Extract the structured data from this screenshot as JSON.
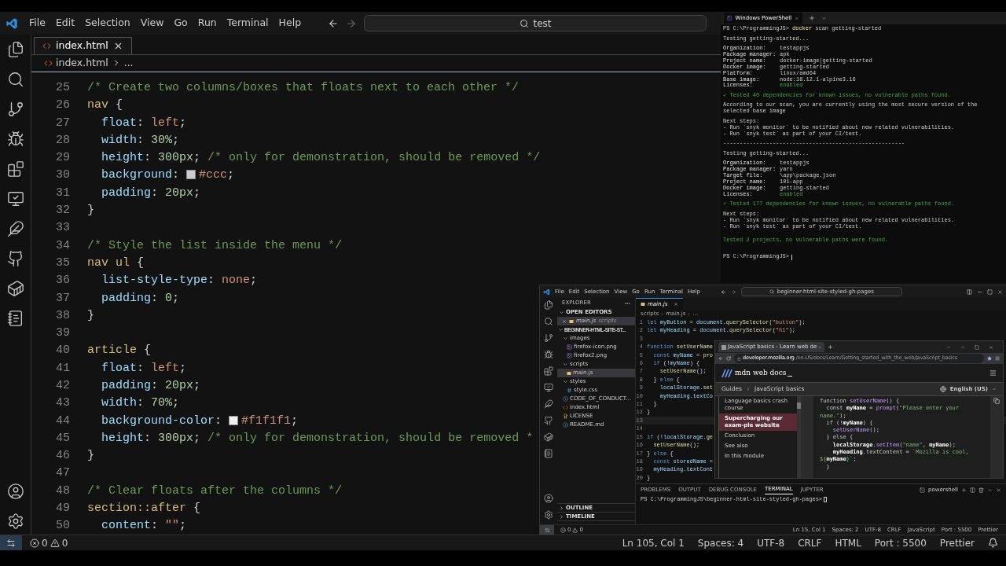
{
  "titlebar": {
    "menu": [
      "File",
      "Edit",
      "Selection",
      "View",
      "Go",
      "Run",
      "Terminal",
      "Help"
    ],
    "search": "test"
  },
  "editor": {
    "tabs": [
      {
        "label": "index.html",
        "selected": true
      }
    ],
    "breadcrumb": [
      "index.html",
      "..."
    ],
    "lines": [
      {
        "n": "25",
        "tokens": [
          {
            "kind": "com",
            "text": "/* Create two columns/boxes that floats next to each other */"
          }
        ]
      },
      {
        "n": "26",
        "tokens": [
          {
            "kind": "sel",
            "text": "nav"
          },
          {
            "kind": "punc",
            "text": " {"
          }
        ]
      },
      {
        "n": "27",
        "tokens": [
          {
            "kind": "prop",
            "text": "  float"
          },
          {
            "kind": "punc",
            "text": ": "
          },
          {
            "kind": "val",
            "text": "left"
          },
          {
            "kind": "punc",
            "text": ";"
          }
        ]
      },
      {
        "n": "28",
        "tokens": [
          {
            "kind": "prop",
            "text": "  width"
          },
          {
            "kind": "punc",
            "text": ": "
          },
          {
            "kind": "num",
            "text": "30%"
          },
          {
            "kind": "punc",
            "text": ";"
          }
        ]
      },
      {
        "n": "29",
        "tokens": [
          {
            "kind": "prop",
            "text": "  height"
          },
          {
            "kind": "punc",
            "text": ": "
          },
          {
            "kind": "num",
            "text": "300"
          },
          {
            "kind": "unit",
            "text": "px"
          },
          {
            "kind": "punc",
            "text": "; "
          },
          {
            "kind": "com",
            "text": "/* only for demonstration, should be removed */"
          }
        ]
      },
      {
        "n": "30",
        "tokens": [
          {
            "kind": "prop",
            "text": "  background"
          },
          {
            "kind": "punc",
            "text": ": "
          },
          {
            "kind": "swatch",
            "color": "#cccccc"
          },
          {
            "kind": "val",
            "text": "#ccc"
          },
          {
            "kind": "punc",
            "text": ";"
          }
        ]
      },
      {
        "n": "31",
        "tokens": [
          {
            "kind": "prop",
            "text": "  padding"
          },
          {
            "kind": "punc",
            "text": ": "
          },
          {
            "kind": "num",
            "text": "20"
          },
          {
            "kind": "unit",
            "text": "px"
          },
          {
            "kind": "punc",
            "text": ";"
          }
        ]
      },
      {
        "n": "32",
        "tokens": [
          {
            "kind": "punc",
            "text": "}"
          }
        ]
      },
      {
        "n": "33"
      },
      {
        "n": "34",
        "tokens": [
          {
            "kind": "com",
            "text": "/* Style the list inside the menu */"
          }
        ]
      },
      {
        "n": "35",
        "tokens": [
          {
            "kind": "sel",
            "text": "nav ul"
          },
          {
            "kind": "punc",
            "text": " {"
          }
        ]
      },
      {
        "n": "36",
        "tokens": [
          {
            "kind": "prop",
            "text": "  list-style-type"
          },
          {
            "kind": "punc",
            "text": ": "
          },
          {
            "kind": "val",
            "text": "none"
          },
          {
            "kind": "punc",
            "text": ";"
          }
        ]
      },
      {
        "n": "37",
        "tokens": [
          {
            "kind": "prop",
            "text": "  padding"
          },
          {
            "kind": "punc",
            "text": ": "
          },
          {
            "kind": "num",
            "text": "0"
          },
          {
            "kind": "punc",
            "text": ";"
          }
        ]
      },
      {
        "n": "38",
        "tokens": [
          {
            "kind": "punc",
            "text": "}"
          }
        ]
      },
      {
        "n": "39"
      },
      {
        "n": "40",
        "tokens": [
          {
            "kind": "sel",
            "text": "article"
          },
          {
            "kind": "punc",
            "text": " {"
          }
        ]
      },
      {
        "n": "41",
        "tokens": [
          {
            "kind": "prop",
            "text": "  float"
          },
          {
            "kind": "punc",
            "text": ": "
          },
          {
            "kind": "val",
            "text": "left"
          },
          {
            "kind": "punc",
            "text": ";"
          }
        ]
      },
      {
        "n": "42",
        "tokens": [
          {
            "kind": "prop",
            "text": "  padding"
          },
          {
            "kind": "punc",
            "text": ": "
          },
          {
            "kind": "num",
            "text": "20"
          },
          {
            "kind": "unit",
            "text": "px"
          },
          {
            "kind": "punc",
            "text": ";"
          }
        ]
      },
      {
        "n": "43",
        "tokens": [
          {
            "kind": "prop",
            "text": "  width"
          },
          {
            "kind": "punc",
            "text": ": "
          },
          {
            "kind": "num",
            "text": "70%"
          },
          {
            "kind": "punc",
            "text": ";"
          }
        ]
      },
      {
        "n": "44",
        "tokens": [
          {
            "kind": "prop",
            "text": "  background-color"
          },
          {
            "kind": "punc",
            "text": ": "
          },
          {
            "kind": "swatch",
            "color": "#f1f1f1"
          },
          {
            "kind": "val",
            "text": "#f1f1f1"
          },
          {
            "kind": "punc",
            "text": ";"
          }
        ]
      },
      {
        "n": "45",
        "tokens": [
          {
            "kind": "prop",
            "text": "  height"
          },
          {
            "kind": "punc",
            "text": ": "
          },
          {
            "kind": "num",
            "text": "300"
          },
          {
            "kind": "unit",
            "text": "px"
          },
          {
            "kind": "punc",
            "text": "; "
          },
          {
            "kind": "com",
            "text": "/* only for demonstration, should be removed *"
          }
        ]
      },
      {
        "n": "46",
        "tokens": [
          {
            "kind": "punc",
            "text": "}"
          }
        ]
      },
      {
        "n": "47"
      },
      {
        "n": "48",
        "tokens": [
          {
            "kind": "com",
            "text": "/* Clear floats after the columns */"
          }
        ]
      },
      {
        "n": "49",
        "tokens": [
          {
            "kind": "sel",
            "text": "section::after"
          },
          {
            "kind": "punc",
            "text": " {"
          }
        ]
      },
      {
        "n": "50",
        "tokens": [
          {
            "kind": "prop",
            "text": "  content"
          },
          {
            "kind": "punc",
            "text": ": "
          },
          {
            "kind": "val",
            "text": "\"\""
          },
          {
            "kind": "punc",
            "text": ";"
          }
        ]
      }
    ]
  },
  "status_bar": {
    "problems": {
      "errors": "0",
      "warnings": "0"
    },
    "items": [
      "Ln 105, Col 1",
      "Spaces: 4",
      "UTF-8",
      "CRLF",
      "HTML",
      "Port : 5500",
      "Prettier"
    ]
  },
  "terminal": {
    "tabs": [
      {
        "title": "Windows PowerShell",
        "selected": true
      }
    ],
    "lines": [
      {
        "kind": "prompt",
        "prompt": "PS C:\\ProgrammingJS>",
        "cmd": "docker",
        "args": "scan getting-started"
      },
      {
        "kind": "blank"
      },
      {
        "kind": "text",
        "text": "Testing getting-started..."
      },
      {
        "kind": "blank"
      },
      {
        "kind": "field",
        "label": "Organization:",
        "value": "testappjs",
        "highlight": false
      },
      {
        "kind": "field",
        "label": "Package manager:",
        "value": "apk",
        "highlight": false
      },
      {
        "kind": "field",
        "label": "Project name:",
        "value": "docker-image|getting-started",
        "highlight": false
      },
      {
        "kind": "field",
        "label": "Docker image:",
        "value": "getting-started",
        "highlight": false
      },
      {
        "kind": "field",
        "label": "Platform:",
        "value": "linux/amd64",
        "highlight": false
      },
      {
        "kind": "field",
        "label": "Base image:",
        "value": "node:18.12.1-alpine3.16",
        "highlight": false
      },
      {
        "kind": "field",
        "label": "Licenses:",
        "value": "enabled",
        "highlight": true
      },
      {
        "kind": "blank"
      },
      {
        "kind": "success",
        "text": "✓ Tested 40 dependencies for known issues, no vulnerable paths found."
      },
      {
        "kind": "blank"
      },
      {
        "kind": "text",
        "text": "According to our scan, you are currently using the most secure version of the selected base image"
      },
      {
        "kind": "blank"
      },
      {
        "kind": "text",
        "text": "Next steps:"
      },
      {
        "kind": "text",
        "text": "- Run `snyk monitor` to be notified about new related vulnerabilities."
      },
      {
        "kind": "text",
        "text": "- Run `snyk test` as part of your CI/test."
      },
      {
        "kind": "blank"
      },
      {
        "kind": "text",
        "text": "-------------------------------------------------------"
      },
      {
        "kind": "blank"
      },
      {
        "kind": "text",
        "text": "Testing getting-started..."
      },
      {
        "kind": "blank"
      },
      {
        "kind": "field",
        "label": "Organization:",
        "value": "testappjs",
        "highlight": false
      },
      {
        "kind": "field",
        "label": "Package manager:",
        "value": "yarn",
        "highlight": false
      },
      {
        "kind": "field",
        "label": "Target file:",
        "value": "\\app\\package.json",
        "highlight": false
      },
      {
        "kind": "field",
        "label": "Project name:",
        "value": "101-app",
        "highlight": false
      },
      {
        "kind": "field",
        "label": "Docker image:",
        "value": "getting-started",
        "highlight": false
      },
      {
        "kind": "field",
        "label": "Licenses:",
        "value": "enabled",
        "highlight": true
      },
      {
        "kind": "blank"
      },
      {
        "kind": "success",
        "text": "✓ Tested 177 dependencies for known issues, no vulnerable paths found."
      },
      {
        "kind": "blank"
      },
      {
        "kind": "text",
        "text": "Next steps:"
      },
      {
        "kind": "text",
        "text": "- Run `snyk monitor` to be notified about new related vulnerabilities."
      },
      {
        "kind": "text",
        "text": "- Run `snyk test` as part of your CI/test."
      },
      {
        "kind": "blank"
      },
      {
        "kind": "blank"
      },
      {
        "kind": "success",
        "text": "Tested 2 projects, no vulnerable paths were found."
      },
      {
        "kind": "blank"
      },
      {
        "kind": "blank"
      },
      {
        "kind": "blank"
      },
      {
        "kind": "prompt",
        "prompt": "PS C:\\ProgrammingJS>"
      }
    ]
  },
  "vscode": {
    "menu": [
      "File",
      "Edit",
      "Selection",
      "View",
      "Go",
      "Run",
      "Terminal",
      "Help"
    ],
    "search": "beginner-html-site-styled-gh-pages",
    "explorer": {
      "title": "EXPLORER",
      "open_editors_title": "OPEN EDITORS",
      "open_editors": [
        {
          "name": "main.js",
          "folder": "scripts",
          "kind": "js",
          "selected": true
        }
      ],
      "root": "BEGINNER-HTML-SITE-ST...",
      "tree": [
        {
          "name": "images",
          "kind": "folder",
          "expanded": true,
          "selected": false,
          "children": [
            {
              "name": "firefox-icon.png",
              "kind": "image",
              "selected": false
            },
            {
              "name": "firefox2.png",
              "kind": "image",
              "selected": false
            }
          ]
        },
        {
          "name": "scripts",
          "kind": "folder",
          "expanded": true,
          "selected": false,
          "children": [
            {
              "name": "main.js",
              "kind": "js",
              "selected": true
            }
          ]
        },
        {
          "name": "styles",
          "kind": "folder",
          "expanded": true,
          "selected": false,
          "children": [
            {
              "name": "style.css",
              "kind": "css",
              "selected": false
            }
          ]
        },
        {
          "name": "CODE_OF_CONDUCT...",
          "kind": "md",
          "selected": false
        },
        {
          "name": "index.html",
          "kind": "html",
          "selected": false
        },
        {
          "name": "LICENSE",
          "kind": "license",
          "selected": false
        },
        {
          "name": "README.md",
          "kind": "info",
          "selected": false
        }
      ],
      "sections": [
        "OUTLINE",
        "TIMELINE"
      ]
    },
    "tabs": [
      {
        "label": "main.js",
        "selected": true
      }
    ],
    "breadcrumb": [
      "scripts",
      "main.js",
      "..."
    ],
    "lines": [
      {
        "n": "1",
        "tokens": [
          {
            "kind": "kw",
            "text": "let "
          },
          {
            "kind": "var",
            "text": "myButton"
          },
          {
            "kind": "punc",
            "text": " = "
          },
          {
            "kind": "var",
            "text": "document"
          },
          {
            "kind": "punc",
            "text": "."
          },
          {
            "kind": "fn",
            "text": "querySelector"
          },
          {
            "kind": "punc",
            "text": "("
          },
          {
            "kind": "str",
            "text": "\"button\""
          },
          {
            "kind": "punc",
            "text": ");"
          }
        ]
      },
      {
        "n": "2",
        "tokens": [
          {
            "kind": "kw",
            "text": "let "
          },
          {
            "kind": "var",
            "text": "myHeading"
          },
          {
            "kind": "punc",
            "text": " = "
          },
          {
            "kind": "var",
            "text": "document"
          },
          {
            "kind": "punc",
            "text": "."
          },
          {
            "kind": "fn",
            "text": "querySelector"
          },
          {
            "kind": "punc",
            "text": "("
          },
          {
            "kind": "str",
            "text": "\"h1\""
          },
          {
            "kind": "punc",
            "text": ");"
          }
        ]
      },
      {
        "n": "3"
      },
      {
        "n": "4",
        "tokens": [
          {
            "kind": "kw",
            "text": "function "
          },
          {
            "kind": "fn",
            "text": "setUserName"
          }
        ]
      },
      {
        "n": "5",
        "tokens": [
          {
            "kind": "kw",
            "text": "  const "
          },
          {
            "kind": "var",
            "text": "myName"
          },
          {
            "kind": "punc",
            "text": " = "
          },
          {
            "kind": "fn",
            "text": "pro"
          }
        ]
      },
      {
        "n": "6",
        "tokens": [
          {
            "kind": "kw",
            "text": "  if "
          },
          {
            "kind": "punc",
            "text": "(!"
          },
          {
            "kind": "var",
            "text": "myName"
          },
          {
            "kind": "punc",
            "text": ") {"
          }
        ]
      },
      {
        "n": "7",
        "tokens": [
          {
            "kind": "fn",
            "text": "    setUserName"
          },
          {
            "kind": "punc",
            "text": "();"
          }
        ]
      },
      {
        "n": "8",
        "tokens": [
          {
            "kind": "punc",
            "text": "  } "
          },
          {
            "kind": "kw",
            "text": "else"
          },
          {
            "kind": "punc",
            "text": " {"
          }
        ]
      },
      {
        "n": "9",
        "tokens": [
          {
            "kind": "var",
            "text": "    localStorage"
          },
          {
            "kind": "punc",
            "text": "."
          },
          {
            "kind": "fn",
            "text": "set"
          }
        ]
      },
      {
        "n": "10",
        "tokens": [
          {
            "kind": "var",
            "text": "    myHeading"
          },
          {
            "kind": "punc",
            "text": "."
          },
          {
            "kind": "var",
            "text": "textCo"
          }
        ]
      },
      {
        "n": "11",
        "tokens": [
          {
            "kind": "punc",
            "text": "  }"
          }
        ]
      },
      {
        "n": "12",
        "tokens": [
          {
            "kind": "punc",
            "text": "}"
          }
        ]
      },
      {
        "n": "13"
      },
      {
        "n": "14"
      },
      {
        "n": "15",
        "tokens": [
          {
            "kind": "kw",
            "text": "if "
          },
          {
            "kind": "punc",
            "text": "(!"
          },
          {
            "kind": "var",
            "text": "localStorage"
          },
          {
            "kind": "punc",
            "text": "."
          },
          {
            "kind": "fn",
            "text": "ge"
          }
        ]
      },
      {
        "n": "16",
        "tokens": [
          {
            "kind": "fn",
            "text": "  setUserName"
          },
          {
            "kind": "punc",
            "text": "();"
          }
        ]
      },
      {
        "n": "17",
        "tokens": [
          {
            "kind": "punc",
            "text": "} "
          },
          {
            "kind": "kw",
            "text": "else"
          },
          {
            "kind": "punc",
            "text": " {"
          }
        ]
      },
      {
        "n": "18",
        "tokens": [
          {
            "kind": "kw",
            "text": "  const "
          },
          {
            "kind": "var",
            "text": "storedName"
          },
          {
            "kind": "punc",
            "text": " ="
          }
        ]
      },
      {
        "n": "19",
        "tokens": [
          {
            "kind": "var",
            "text": "  myHeading"
          },
          {
            "kind": "punc",
            "text": "."
          },
          {
            "kind": "var",
            "text": "textCont"
          }
        ]
      },
      {
        "n": "20",
        "tokens": [
          {
            "kind": "punc",
            "text": "}"
          }
        ]
      }
    ],
    "panel_tabs": [
      {
        "label": "PROBLEMS",
        "selected": false
      },
      {
        "label": "OUTPUT",
        "selected": false
      },
      {
        "label": "DEBUG CONSOLE",
        "selected": false
      },
      {
        "label": "TERMINAL",
        "selected": true
      },
      {
        "label": "JUPYTER",
        "selected": false
      }
    ],
    "shell": "powershell",
    "terminal_prompt": "PS C:\\ProgrammingJS\\beginner-html-site-styled-gh-pages>",
    "status_bar": {
      "problems": {
        "errors": "0",
        "warnings": "0"
      },
      "items": [
        "Ln 15, Col 1",
        "Spaces: 2",
        "UTF-8",
        "CRLF",
        "JavaScript",
        "Port : 5500",
        "Prettier"
      ]
    }
  },
  "browser": {
    "tabs": [
      {
        "title": "JavaScript basics - Learn web de",
        "selected": true
      }
    ],
    "url_host": "developer.mozilla.org",
    "url_path": "/en-US/docs/Learn/Getting_started_with_the_web/JavaScript_basics",
    "site": "mdn web docs",
    "breadcrumb": [
      "Guides",
      "JavaScript basics"
    ],
    "language": "English (US)",
    "nav": [
      {
        "label": "Language basics crash course",
        "selected": false
      },
      {
        "label": "Supercharging our exam-ple website",
        "selected": true
      },
      {
        "label": "Conclusion",
        "selected": false
      },
      {
        "label": "See also",
        "selected": false
      },
      {
        "label": "In this module",
        "selected": false
      }
    ],
    "code": [
      [
        {
          "kind": "plain",
          "text": "function "
        },
        {
          "kind": "fn",
          "text": "setUserName"
        },
        {
          "kind": "plain",
          "text": "() {"
        }
      ],
      [
        {
          "kind": "plain",
          "text": "  const "
        },
        {
          "kind": "bold",
          "text": "myName"
        },
        {
          "kind": "plain",
          "text": " = "
        },
        {
          "kind": "fn",
          "text": "prompt"
        },
        {
          "kind": "plain",
          "text": "("
        },
        {
          "kind": "str",
          "text": "\"Please enter your"
        }
      ],
      [
        {
          "kind": "str",
          "text": "name.\""
        },
        {
          "kind": "plain",
          "text": ");"
        }
      ],
      [
        {
          "kind": "plain",
          "text": "  if (!"
        },
        {
          "kind": "bold",
          "text": "myName"
        },
        {
          "kind": "plain",
          "text": ") {"
        }
      ],
      [
        {
          "kind": "fn",
          "text": "    setUserName"
        },
        {
          "kind": "plain",
          "text": "();"
        }
      ],
      [
        {
          "kind": "plain",
          "text": "  } else {"
        }
      ],
      [
        {
          "kind": "bold",
          "text": "    localStorage"
        },
        {
          "kind": "plain",
          "text": "."
        },
        {
          "kind": "fn",
          "text": "setItem"
        },
        {
          "kind": "plain",
          "text": "("
        },
        {
          "kind": "str",
          "text": "\"name\""
        },
        {
          "kind": "plain",
          "text": ", "
        },
        {
          "kind": "bold",
          "text": "myName"
        },
        {
          "kind": "plain",
          "text": ");"
        }
      ],
      [
        {
          "kind": "bold",
          "text": "    myHeading"
        },
        {
          "kind": "plain",
          "text": ".textContent = "
        },
        {
          "kind": "str",
          "text": "`Mozilla is cool,"
        }
      ],
      [
        {
          "kind": "str",
          "text": "${"
        },
        {
          "kind": "bold",
          "text": "myName"
        },
        {
          "kind": "str",
          "text": "}`"
        },
        {
          "kind": "plain",
          "text": ";"
        }
      ],
      [
        {
          "kind": "plain",
          "text": "  }"
        }
      ]
    ]
  }
}
